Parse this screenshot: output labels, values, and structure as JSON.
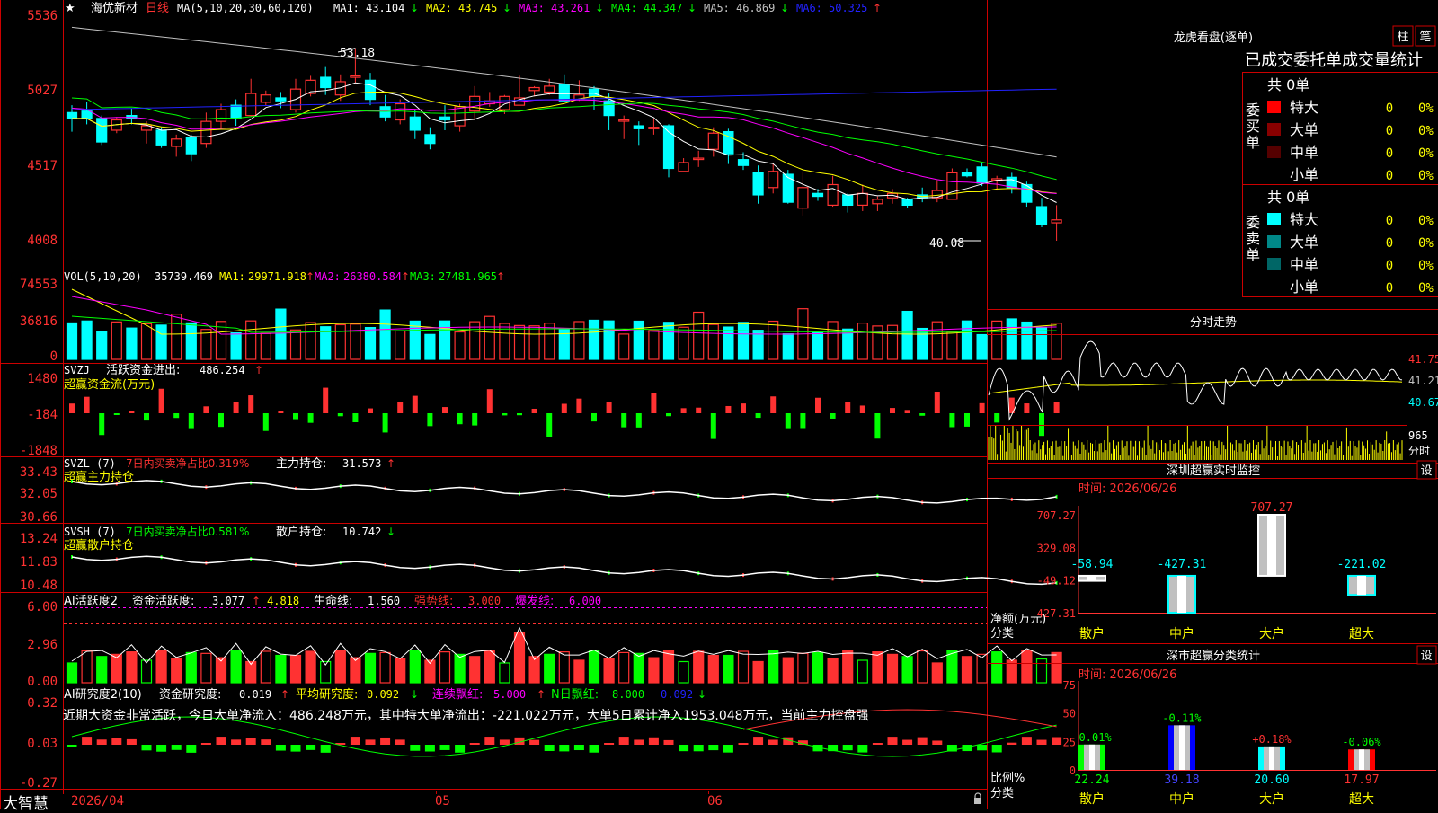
{
  "colors": {
    "up": "#ff3232",
    "down": "#00ffff",
    "grid": "#cc0000",
    "ma1": "#ffffff",
    "ma2": "#ffff00",
    "ma3": "#ff00ff",
    "ma4": "#00ff00",
    "ma5": "#c0c0c0",
    "ma6": "#2222ff",
    "green": "#00ff00",
    "yellow": "#ffff00"
  },
  "main_chart": {
    "star": "★",
    "stock_name": "海优新材",
    "period": "日线",
    "ma_label": "MA(5,10,20,30,60,120)",
    "ma": [
      {
        "label": "MA1:",
        "value": "43.104",
        "arrow": "↓"
      },
      {
        "label": "MA2:",
        "value": "43.745",
        "arrow": "↓"
      },
      {
        "label": "MA3:",
        "value": "43.261",
        "arrow": "↓"
      },
      {
        "label": "MA4:",
        "value": "44.347",
        "arrow": "↓"
      },
      {
        "label": "MA5:",
        "value": "46.869",
        "arrow": "↓"
      },
      {
        "label": "MA6:",
        "value": "50.325",
        "arrow": "↑"
      }
    ],
    "y_ticks": [
      "5536",
      "5027",
      "4517",
      "4008"
    ],
    "high_label": "53.18",
    "low_label": "40.08"
  },
  "vol_panel": {
    "label": "VOL(5,10,20)",
    "value": "35739.469",
    "ma": [
      {
        "label": "MA1:",
        "value": "29971.918",
        "arrow": "↑"
      },
      {
        "label": "MA2:",
        "value": "26380.584",
        "arrow": "↑"
      },
      {
        "label": "MA3:",
        "value": "27481.965",
        "arrow": "↑"
      }
    ],
    "y_ticks": [
      "74553",
      "36816",
      "0"
    ]
  },
  "svzj_panel": {
    "label": "SVZJ",
    "metric": "活跃资金进出:",
    "value": "486.254",
    "arrow": "↑",
    "subtitle": "超赢资金流(万元)",
    "y_ticks": [
      "1480",
      "-184",
      "-1848"
    ]
  },
  "svzl_panel": {
    "label": "SVZL (7)",
    "ratio_text": "7日内买卖净占比0.319%",
    "metric": "主力持仓:",
    "value": "31.573",
    "arrow": "↑",
    "subtitle": "超赢主力持仓",
    "y_ticks": [
      "33.43",
      "32.05",
      "30.66"
    ]
  },
  "svsh_panel": {
    "label": "SVSH (7)",
    "ratio_text": "7日内买卖净占比0.581%",
    "metric": "散户持仓:",
    "value": "10.742",
    "arrow": "↓",
    "subtitle": "超赢散户持仓",
    "y_ticks": [
      "13.24",
      "11.83",
      "10.48"
    ]
  },
  "ai_active_panel": {
    "label": "AI活跃度2",
    "metric": "资金活跃度:",
    "value": "3.077",
    "arrow": "↑",
    "value2": "4.818",
    "life_label": "生命线:",
    "life_value": "1.560",
    "strong_label": "强势线:",
    "strong_value": "3.000",
    "burst_label": "爆发线:",
    "burst_value": "6.000",
    "y_ticks": [
      "6.00",
      "2.96",
      "0.00"
    ]
  },
  "ai_research_panel": {
    "label": "AI研究度2(10)",
    "metric": "资金研究度:",
    "value": "0.019",
    "arrow": "↑",
    "avg_label": "平均研究度:",
    "avg_value": "0.092",
    "avg_arrow": "↓",
    "red_label": "连续飘红:",
    "red_value": "5.000",
    "red_arrow": "↑",
    "nred_label": "N日飘红:",
    "nred_value": "8.000",
    "extra_value": "0.092",
    "extra_arrow": "↓",
    "summary": "近期大资金非常活跃，今日大单净流入：486.248万元，其中特大单净流出：-221.022万元，大单5日累计净入1953.048万元，当前主力控盘强",
    "y_ticks": [
      "0.32",
      "0.03",
      "-0.27"
    ]
  },
  "time_axis": {
    "labels": [
      "2026/04",
      "05",
      "06"
    ]
  },
  "brand": "大智慧",
  "right_panel": {
    "dragon_title": "龙虎看盘(逐单)",
    "btn_bar": "柱",
    "btn_brush": "笔",
    "order_title": "已成交委托单成交量统计",
    "buy": {
      "side_label": "委买单",
      "total": "共 0单",
      "rows": [
        {
          "name": "特大",
          "value": "0",
          "pct": "0%",
          "color": "#ff0000"
        },
        {
          "name": "大单",
          "value": "0",
          "pct": "0%",
          "color": "#880000"
        },
        {
          "name": "中单",
          "value": "0",
          "pct": "0%",
          "color": "#550000"
        },
        {
          "name": "小单",
          "value": "0",
          "pct": "0%",
          "color": "#000000"
        }
      ]
    },
    "sell": {
      "side_label": "委卖单",
      "total": "共 0单",
      "rows": [
        {
          "name": "特大",
          "value": "0",
          "pct": "0%",
          "color": "#00ffff"
        },
        {
          "name": "大单",
          "value": "0",
          "pct": "0%",
          "color": "#008888"
        },
        {
          "name": "中单",
          "value": "0",
          "pct": "0%",
          "color": "#006666"
        },
        {
          "name": "小单",
          "value": "0",
          "pct": "0%",
          "color": "#000000"
        }
      ]
    },
    "intraday": {
      "title": "分时走势",
      "price_ticks": [
        "41.75",
        "41.21",
        "40.67"
      ],
      "vol_tick": "965",
      "vol_label": "分时"
    },
    "sz_monitor": {
      "title": "深圳超赢实时监控",
      "setting": "设",
      "time_label": "时间: 2026/06/26",
      "y_ticks": [
        "707.27",
        "329.08",
        "-49.12",
        "-427.31"
      ],
      "ylabel": "净额(万元)",
      "xlabel": "分类",
      "categories": [
        "散户",
        "中户",
        "大户",
        "超大"
      ],
      "values": [
        -58.94,
        -427.31,
        707.27,
        -221.02
      ],
      "value_labels": [
        "-58.94",
        "-427.31",
        "707.27",
        "-221.02"
      ]
    },
    "sz_class": {
      "title": "深市超赢分类统计",
      "setting": "设",
      "time_label": "时间: 2026/06/26",
      "y_ticks": [
        "75",
        "50",
        "25",
        "0"
      ],
      "ylabel": "比例%",
      "xlabel": "分类",
      "categories": [
        "散户",
        "中户",
        "大户",
        "超大"
      ],
      "values": [
        22.24,
        39.18,
        20.6,
        17.97
      ],
      "value_labels": [
        "22.24",
        "39.18",
        "20.60",
        "17.97"
      ],
      "change_labels": [
        "-0.01%",
        "-0.11%",
        "+0.18%",
        "-0.06%"
      ]
    }
  },
  "chart_data": [
    {
      "type": "line",
      "title": "",
      "x": [
        "2026/04",
        "05",
        "06"
      ],
      "series": [
        {
          "name": "MA1",
          "last": 43.104
        },
        {
          "name": "MA2",
          "last": 43.745
        },
        {
          "name": "MA3",
          "last": 43.261
        },
        {
          "name": "MA4",
          "last": 44.347
        },
        {
          "name": "MA5",
          "last": 46.869
        },
        {
          "name": "MA6",
          "last": 50.325
        }
      ],
      "ylim": [
        40.08,
        55.36
      ],
      "candles": [
        [
          48.8,
          48.4,
          49.3,
          47.5
        ],
        [
          48.9,
          48.4,
          49.5,
          48.0
        ],
        [
          48.4,
          46.8,
          48.6,
          46.6
        ],
        [
          47.6,
          48.3,
          48.5,
          47.4
        ],
        [
          48.6,
          48.4,
          49.1,
          48.0
        ],
        [
          47.6,
          47.9,
          48.2,
          46.7
        ],
        [
          47.6,
          46.6,
          47.8,
          46.4
        ],
        [
          46.5,
          47.0,
          47.3,
          45.8
        ],
        [
          47.1,
          46.0,
          47.3,
          45.5
        ],
        [
          46.7,
          48.2,
          48.8,
          46.4
        ],
        [
          48.2,
          49.0,
          49.4,
          47.7
        ],
        [
          49.3,
          48.4,
          49.7,
          47.9
        ],
        [
          48.6,
          50.1,
          51.1,
          48.5
        ],
        [
          49.5,
          50.0,
          50.3,
          49.3
        ],
        [
          49.8,
          49.6,
          50.2,
          49.1
        ],
        [
          49.0,
          50.4,
          51.1,
          48.8
        ],
        [
          50.1,
          51.0,
          51.3,
          49.9
        ],
        [
          51.2,
          50.5,
          51.9,
          50.0
        ],
        [
          50.0,
          50.9,
          51.4,
          49.6
        ],
        [
          51.2,
          51.3,
          53.18,
          50.8
        ],
        [
          51.0,
          49.7,
          51.5,
          49.3
        ],
        [
          49.2,
          48.5,
          50.0,
          48.2
        ],
        [
          48.3,
          49.4,
          49.7,
          48.0
        ],
        [
          48.5,
          47.6,
          49.0,
          47.0
        ],
        [
          47.3,
          46.7,
          47.8,
          46.3
        ],
        [
          48.5,
          48.3,
          49.3,
          47.6
        ],
        [
          47.9,
          49.2,
          49.4,
          47.5
        ],
        [
          48.9,
          49.9,
          50.6,
          48.3
        ],
        [
          49.4,
          49.6,
          50.2,
          49.2
        ],
        [
          49.0,
          49.9,
          50.0,
          48.7
        ],
        [
          49.3,
          49.8,
          51.3,
          49.3
        ],
        [
          50.3,
          50.5,
          50.6,
          49.9
        ],
        [
          50.2,
          50.6,
          51.1,
          50.0
        ],
        [
          50.7,
          49.6,
          51.4,
          49.6
        ],
        [
          49.7,
          50.0,
          51.0,
          49.6
        ],
        [
          50.4,
          49.9,
          50.6,
          49.0
        ],
        [
          49.6,
          48.6,
          50.1,
          47.6
        ],
        [
          48.3,
          48.3,
          48.6,
          47.0
        ],
        [
          47.9,
          47.7,
          48.2,
          46.6
        ],
        [
          47.7,
          47.8,
          48.4,
          47.3
        ],
        [
          47.9,
          45.0,
          48.0,
          44.4
        ],
        [
          44.8,
          45.4,
          45.7,
          45.2
        ],
        [
          45.7,
          45.7,
          46.2,
          45.1
        ],
        [
          46.3,
          47.4,
          47.8,
          45.8
        ],
        [
          47.5,
          46.0,
          47.7,
          45.3
        ],
        [
          45.6,
          45.2,
          46.1,
          44.9
        ],
        [
          44.7,
          43.2,
          45.2,
          42.6
        ],
        [
          43.7,
          44.8,
          45.4,
          43.3
        ],
        [
          44.6,
          42.7,
          44.9,
          42.6
        ],
        [
          42.3,
          43.7,
          44.8,
          41.8
        ],
        [
          43.3,
          43.1,
          43.6,
          42.8
        ],
        [
          42.5,
          43.9,
          44.5,
          42.4
        ],
        [
          43.2,
          42.5,
          43.3,
          42.0
        ],
        [
          42.5,
          43.3,
          43.9,
          42.1
        ],
        [
          42.6,
          42.9,
          43.1,
          42.1
        ],
        [
          43.0,
          43.3,
          43.6,
          42.6
        ],
        [
          42.9,
          42.5,
          43.0,
          42.3
        ],
        [
          43.2,
          43.0,
          43.7,
          42.7
        ],
        [
          43.0,
          43.5,
          44.2,
          42.7
        ],
        [
          42.9,
          44.7,
          45.0,
          42.9
        ],
        [
          44.7,
          44.5,
          45.0,
          44.4
        ],
        [
          45.1,
          44.0,
          45.4,
          43.8
        ],
        [
          44.2,
          44.3,
          44.5,
          43.5
        ],
        [
          44.4,
          43.7,
          44.7,
          43.3
        ],
        [
          43.9,
          42.7,
          44.1,
          42.4
        ],
        [
          42.4,
          41.2,
          43.0,
          41.0
        ],
        [
          41.3,
          41.5,
          42.5,
          40.08
        ]
      ]
    },
    {
      "type": "bar",
      "title": "",
      "series": [
        {
          "name": "VOL",
          "last": 35739.469
        }
      ],
      "ylim": [
        0,
        74553
      ]
    },
    {
      "type": "bar",
      "title": "",
      "x": [
        "散户",
        "中户",
        "大户",
        "超大"
      ],
      "values": [
        -58.94,
        -427.31,
        707.27,
        -221.02
      ],
      "ylabel": "净额(万元)",
      "xlabel": "分类",
      "ylim": [
        -427.31,
        707.27
      ]
    },
    {
      "type": "bar",
      "title": "",
      "x": [
        "散户",
        "中户",
        "大户",
        "超大"
      ],
      "values": [
        22.24,
        39.18,
        20.6,
        17.97
      ],
      "ylabel": "比例%",
      "xlabel": "分类",
      "ylim": [
        0,
        75
      ]
    }
  ]
}
